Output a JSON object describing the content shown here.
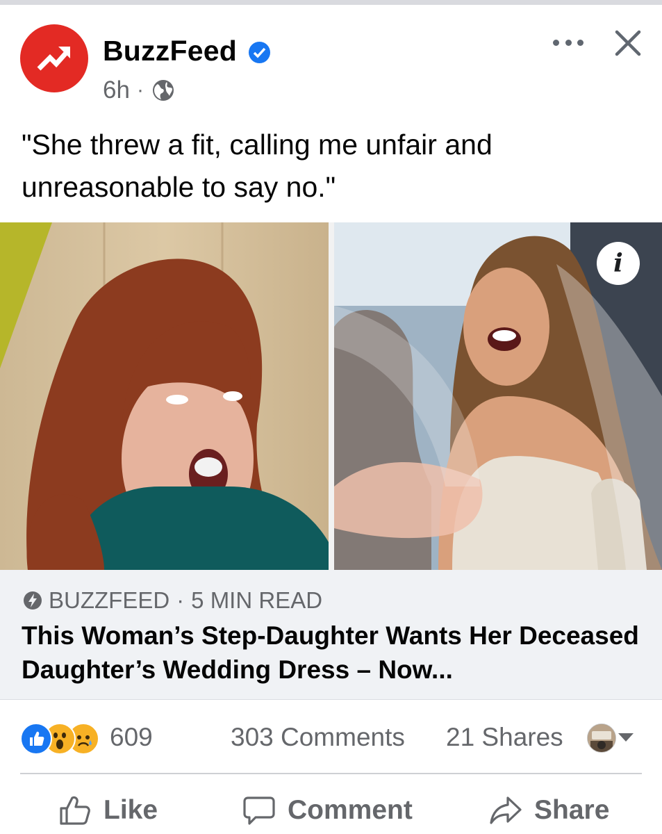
{
  "post": {
    "page_name": "BuzzFeed",
    "time": "6h",
    "separator": "·",
    "text": "\"She threw a fit, calling me unfair and unreasonable to say no.\""
  },
  "link_preview": {
    "source": "BUZZFEED",
    "separator": "·",
    "read_time": "5 MIN READ",
    "title": "This Woman’s Step-Daughter Wants Her Deceased Daughter’s Wedding Dress – Now..."
  },
  "engagement": {
    "reaction_count": "609",
    "reactions": [
      "like",
      "wow",
      "sad"
    ],
    "comments": "303 Comments",
    "shares": "21 Shares"
  },
  "actions": {
    "like": "Like",
    "comment": "Comment",
    "share": "Share"
  },
  "colors": {
    "brand_red": "#e32a24",
    "verified_blue": "#1877f2",
    "secondary_text": "#65676b",
    "link_bg": "#f0f2f5"
  }
}
